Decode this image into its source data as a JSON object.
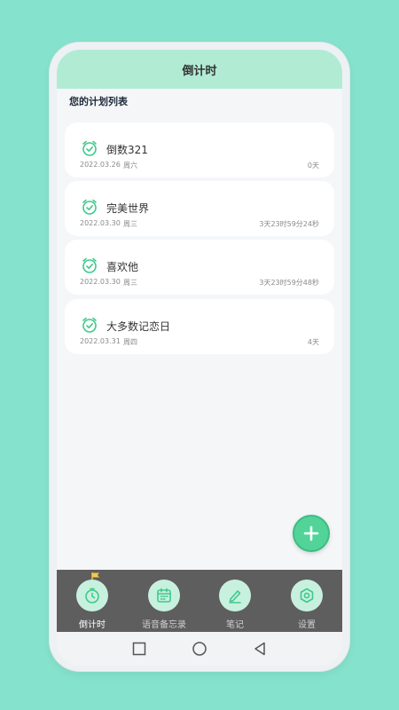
{
  "header": {
    "title": "倒计时"
  },
  "section": {
    "title": "您的计划列表"
  },
  "plans": [
    {
      "title": "倒数321",
      "date": "2022.03.26",
      "weekday": "周六",
      "remaining": "0天"
    },
    {
      "title": "完美世界",
      "date": "2022.03.30",
      "weekday": "周三",
      "remaining": "3天23时59分24秒"
    },
    {
      "title": "喜欢他",
      "date": "2022.03.30",
      "weekday": "周三",
      "remaining": "3天23时59分48秒"
    },
    {
      "title": "大多数记恋日",
      "date": "2022.03.31",
      "weekday": "周四",
      "remaining": "4天"
    }
  ],
  "tabs": [
    {
      "label": "倒计时",
      "icon": "timer-icon",
      "active": true
    },
    {
      "label": "语音备忘录",
      "icon": "calendar-icon",
      "active": false
    },
    {
      "label": "笔记",
      "icon": "pen-icon",
      "active": false
    },
    {
      "label": "设置",
      "icon": "settings-icon",
      "active": false
    }
  ],
  "fab": {
    "icon": "plus-icon"
  },
  "system_nav": {
    "icons": [
      "recents-square-icon",
      "home-circle-icon",
      "back-triangle-icon"
    ]
  },
  "colors": {
    "accent": "#52d499",
    "header": "#b2ebd4",
    "tabbar": "#5e5e5e",
    "background": "#85e2cd"
  }
}
